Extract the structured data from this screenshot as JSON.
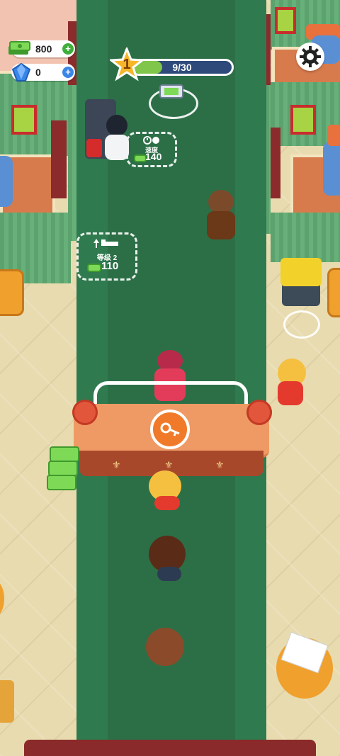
{
  "hud": {
    "cash_value": "800",
    "gems_value": "0",
    "level_number": "1",
    "xp_text": "9/30",
    "xp_fraction": 0.3,
    "plus_symbol": "+"
  },
  "upgrades": {
    "housekeeper_speed": {
      "label": "速度",
      "cost": "140",
      "icon": "speed-clock-icon"
    },
    "room_level": {
      "label": "等级 2",
      "cost": "110",
      "icon": "bed-upgrade-icon"
    }
  },
  "icons": {
    "cash": "cash-stack-icon",
    "gem": "blue-gem-icon",
    "settings": "gear-icon",
    "level": "star-icon",
    "desk_action": "key-icon"
  },
  "colors": {
    "carpet": "#2f7a4e",
    "cash_plus": "#3fae3a",
    "gem_plus": "#3a86e8",
    "xp_bar_bg": "#2d4a7a",
    "xp_fill": "#7fc64a",
    "star": "#f7b62a",
    "key_button": "#f07a2a"
  }
}
